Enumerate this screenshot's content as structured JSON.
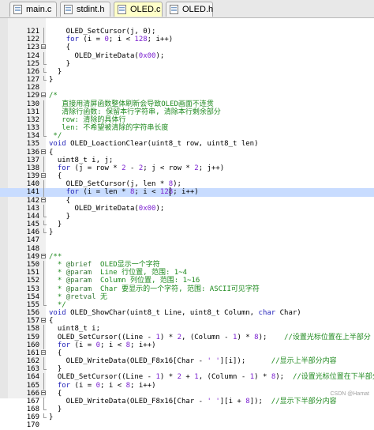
{
  "tabs": [
    {
      "label": "main.c",
      "active": false
    },
    {
      "label": "stdint.h",
      "active": false
    },
    {
      "label": "OLED.c",
      "active": true
    },
    {
      "label": "OLED.h",
      "active": false
    }
  ],
  "code_lines": [
    {
      "num": "121",
      "fold": "line",
      "segs": [
        [
          "p",
          "    OLED_SetCursor(j, 0);"
        ]
      ]
    },
    {
      "num": "122",
      "fold": "line",
      "segs": [
        [
          "p",
          "    "
        ],
        [
          "k",
          "for"
        ],
        [
          "p",
          " (i = "
        ],
        [
          "n",
          "0"
        ],
        [
          "p",
          "; i < "
        ],
        [
          "n",
          "128"
        ],
        [
          "p",
          "; i++)"
        ]
      ]
    },
    {
      "num": "123",
      "fold": "box",
      "segs": [
        [
          "p",
          "    {"
        ]
      ]
    },
    {
      "num": "124",
      "fold": "line",
      "segs": [
        [
          "p",
          "      OLED_WriteData("
        ],
        [
          "n",
          "0x00"
        ],
        [
          "p",
          ");"
        ]
      ]
    },
    {
      "num": "125",
      "fold": "end",
      "segs": [
        [
          "p",
          "    }"
        ]
      ]
    },
    {
      "num": "126",
      "fold": "end",
      "segs": [
        [
          "p",
          "  }"
        ]
      ]
    },
    {
      "num": "127",
      "fold": "end",
      "segs": [
        [
          "p",
          "}"
        ]
      ]
    },
    {
      "num": "128",
      "fold": "",
      "segs": [
        [
          "p",
          ""
        ]
      ]
    },
    {
      "num": "129",
      "fold": "box",
      "segs": [
        [
          "c",
          "/*"
        ]
      ]
    },
    {
      "num": "130",
      "fold": "line",
      "segs": [
        [
          "c",
          "   直接用清屏函数整体刷新会导致OLED画面不连贯"
        ]
      ]
    },
    {
      "num": "131",
      "fold": "line",
      "segs": [
        [
          "c",
          "   清除行函数: 保留本行字符串, 清除本行剩余部分"
        ]
      ]
    },
    {
      "num": "132",
      "fold": "line",
      "segs": [
        [
          "c",
          "   row: 清除的具体行"
        ]
      ]
    },
    {
      "num": "133",
      "fold": "line",
      "segs": [
        [
          "c",
          "   len: 不希望被清除的字符串长度"
        ]
      ]
    },
    {
      "num": "134",
      "fold": "end",
      "segs": [
        [
          "c",
          " */"
        ]
      ]
    },
    {
      "num": "135",
      "fold": "",
      "segs": [
        [
          "k",
          "void"
        ],
        [
          "p",
          " OLED_LoactionClear(uint8_t row, uint8_t len)"
        ]
      ]
    },
    {
      "num": "136",
      "fold": "box",
      "segs": [
        [
          "p",
          "{"
        ]
      ]
    },
    {
      "num": "137",
      "fold": "line",
      "segs": [
        [
          "p",
          "  uint8_t i, j;"
        ]
      ]
    },
    {
      "num": "138",
      "fold": "line",
      "segs": [
        [
          "p",
          "  "
        ],
        [
          "k",
          "for"
        ],
        [
          "p",
          " (j = row * "
        ],
        [
          "n",
          "2"
        ],
        [
          "p",
          " - "
        ],
        [
          "n",
          "2"
        ],
        [
          "p",
          "; j < row * "
        ],
        [
          "n",
          "2"
        ],
        [
          "p",
          "; j++)"
        ]
      ]
    },
    {
      "num": "139",
      "fold": "box",
      "segs": [
        [
          "p",
          "  {"
        ]
      ]
    },
    {
      "num": "140",
      "fold": "line",
      "segs": [
        [
          "p",
          "    OLED_SetCursor(j, len * "
        ],
        [
          "n",
          "8"
        ],
        [
          "p",
          ");"
        ]
      ]
    },
    {
      "num": "141",
      "fold": "line",
      "hl": true,
      "segs": [
        [
          "p",
          "    "
        ],
        [
          "k",
          "for"
        ],
        [
          "p",
          " (i = len * "
        ],
        [
          "n",
          "8"
        ],
        [
          "p",
          "; i < "
        ],
        [
          "n",
          "128"
        ],
        [
          "p",
          "; i++)"
        ]
      ]
    },
    {
      "num": "142",
      "fold": "box",
      "segs": [
        [
          "p",
          "    {"
        ]
      ]
    },
    {
      "num": "143",
      "fold": "line",
      "segs": [
        [
          "p",
          "      OLED_WriteData("
        ],
        [
          "n",
          "0x00"
        ],
        [
          "p",
          ");"
        ]
      ]
    },
    {
      "num": "144",
      "fold": "end",
      "segs": [
        [
          "p",
          "    }"
        ]
      ]
    },
    {
      "num": "145",
      "fold": "end",
      "segs": [
        [
          "p",
          "  }"
        ]
      ]
    },
    {
      "num": "146",
      "fold": "end",
      "segs": [
        [
          "p",
          "}"
        ]
      ]
    },
    {
      "num": "147",
      "fold": "",
      "segs": [
        [
          "p",
          ""
        ]
      ]
    },
    {
      "num": "148",
      "fold": "",
      "segs": [
        [
          "p",
          ""
        ]
      ]
    },
    {
      "num": "149",
      "fold": "box",
      "segs": [
        [
          "c",
          "/**"
        ]
      ]
    },
    {
      "num": "150",
      "fold": "line",
      "segs": [
        [
          "c",
          "  * "
        ],
        [
          "t",
          "@brief"
        ],
        [
          "c",
          "  OLED显示一个字符"
        ]
      ]
    },
    {
      "num": "151",
      "fold": "line",
      "segs": [
        [
          "c",
          "  * "
        ],
        [
          "t",
          "@param"
        ],
        [
          "c",
          "  Line 行位置, 范围: 1~4"
        ]
      ]
    },
    {
      "num": "152",
      "fold": "line",
      "segs": [
        [
          "c",
          "  * "
        ],
        [
          "t",
          "@param"
        ],
        [
          "c",
          "  Column 列位置, 范围: 1~16"
        ]
      ]
    },
    {
      "num": "153",
      "fold": "line",
      "segs": [
        [
          "c",
          "  * "
        ],
        [
          "t",
          "@param"
        ],
        [
          "c",
          "  Char 要显示的一个字符, 范围: ASCII可见字符"
        ]
      ]
    },
    {
      "num": "154",
      "fold": "line",
      "segs": [
        [
          "c",
          "  * "
        ],
        [
          "t",
          "@retval"
        ],
        [
          "c",
          " 无"
        ]
      ]
    },
    {
      "num": "155",
      "fold": "end",
      "segs": [
        [
          "c",
          "  */"
        ]
      ]
    },
    {
      "num": "156",
      "fold": "",
      "segs": [
        [
          "k",
          "void"
        ],
        [
          "p",
          " OLED_ShowChar(uint8_t Line, uint8_t Column, "
        ],
        [
          "k",
          "char"
        ],
        [
          "p",
          " Char)"
        ]
      ]
    },
    {
      "num": "157",
      "fold": "box",
      "segs": [
        [
          "p",
          "{"
        ]
      ]
    },
    {
      "num": "158",
      "fold": "line",
      "segs": [
        [
          "p",
          "  uint8_t i;"
        ]
      ]
    },
    {
      "num": "159",
      "fold": "line",
      "segs": [
        [
          "p",
          "  OLED_SetCursor((Line - "
        ],
        [
          "n",
          "1"
        ],
        [
          "p",
          ") * "
        ],
        [
          "n",
          "2"
        ],
        [
          "p",
          ", (Column - "
        ],
        [
          "n",
          "1"
        ],
        [
          "p",
          ") * "
        ],
        [
          "n",
          "8"
        ],
        [
          "p",
          ");    "
        ],
        [
          "c",
          "//设置光标位置在上半部分"
        ]
      ]
    },
    {
      "num": "160",
      "fold": "line",
      "segs": [
        [
          "p",
          "  "
        ],
        [
          "k",
          "for"
        ],
        [
          "p",
          " (i = "
        ],
        [
          "n",
          "0"
        ],
        [
          "p",
          "; i < "
        ],
        [
          "n",
          "8"
        ],
        [
          "p",
          "; i++)"
        ]
      ]
    },
    {
      "num": "161",
      "fold": "box",
      "segs": [
        [
          "p",
          "  {"
        ]
      ]
    },
    {
      "num": "162",
      "fold": "line",
      "segs": [
        [
          "p",
          "    OLED_WriteData(OLED_F8x16[Char - "
        ],
        [
          "kd",
          "' '"
        ],
        [
          "p",
          "][i]);      "
        ],
        [
          "c",
          "//显示上半部分内容"
        ]
      ]
    },
    {
      "num": "163",
      "fold": "end",
      "segs": [
        [
          "p",
          "  }"
        ]
      ]
    },
    {
      "num": "164",
      "fold": "line",
      "segs": [
        [
          "p",
          "  OLED_SetCursor((Line - "
        ],
        [
          "n",
          "1"
        ],
        [
          "p",
          ") * "
        ],
        [
          "n",
          "2"
        ],
        [
          "p",
          " + "
        ],
        [
          "n",
          "1"
        ],
        [
          "p",
          ", (Column - "
        ],
        [
          "n",
          "1"
        ],
        [
          "p",
          ") * "
        ],
        [
          "n",
          "8"
        ],
        [
          "p",
          ");  "
        ],
        [
          "c",
          "//设置光标位置在下半部分"
        ]
      ]
    },
    {
      "num": "165",
      "fold": "line",
      "segs": [
        [
          "p",
          "  "
        ],
        [
          "k",
          "for"
        ],
        [
          "p",
          " (i = "
        ],
        [
          "n",
          "0"
        ],
        [
          "p",
          "; i < "
        ],
        [
          "n",
          "8"
        ],
        [
          "p",
          "; i++)"
        ]
      ]
    },
    {
      "num": "166",
      "fold": "box",
      "segs": [
        [
          "p",
          "  {"
        ]
      ]
    },
    {
      "num": "167",
      "fold": "line",
      "segs": [
        [
          "p",
          "    OLED_WriteData(OLED_F8x16[Char - "
        ],
        [
          "kd",
          "' '"
        ],
        [
          "p",
          "][i + "
        ],
        [
          "n",
          "8"
        ],
        [
          "p",
          "]);  "
        ],
        [
          "c",
          "//显示下半部分内容"
        ]
      ]
    },
    {
      "num": "168",
      "fold": "end",
      "segs": [
        [
          "p",
          "  }"
        ]
      ]
    },
    {
      "num": "169",
      "fold": "end",
      "segs": [
        [
          "p",
          "}"
        ]
      ]
    },
    {
      "num": "170",
      "fold": "",
      "segs": [
        [
          "p",
          ""
        ]
      ]
    }
  ],
  "watermark": "CSDN @Hamat"
}
